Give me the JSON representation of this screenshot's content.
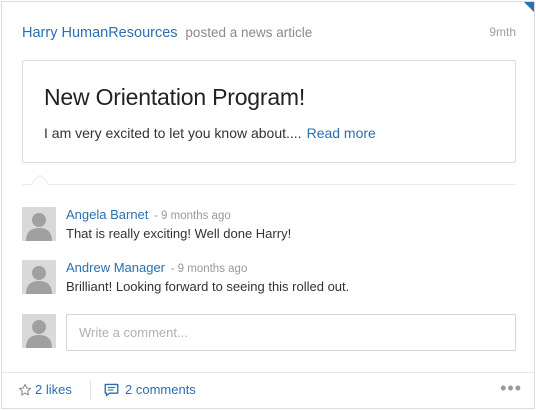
{
  "post": {
    "author": "Harry HumanResources",
    "action": "posted a news article",
    "timestamp": "9mth"
  },
  "article": {
    "title": "New Orientation Program!",
    "excerpt": "I am very excited to let you know about....",
    "read_more": "Read more"
  },
  "comments": [
    {
      "name": "Angela Barnet",
      "time": "- 9 months ago",
      "text": "That is really exciting! Well done Harry!"
    },
    {
      "name": "Andrew Manager",
      "time": "- 9 months ago",
      "text": "Brilliant! Looking forward to seeing this rolled out."
    }
  ],
  "compose": {
    "placeholder": "Write a comment..."
  },
  "footer": {
    "likes_label": "2 likes",
    "comments_label": "2 comments",
    "more_label": "•••"
  },
  "colors": {
    "accent": "#2a6fb0",
    "avatar_bg": "#d9d9d9",
    "avatar_fg": "#a0a0a0"
  },
  "icons": {
    "like": "star-icon",
    "comments": "comment-bubble-icon",
    "more": "ellipsis-icon"
  }
}
